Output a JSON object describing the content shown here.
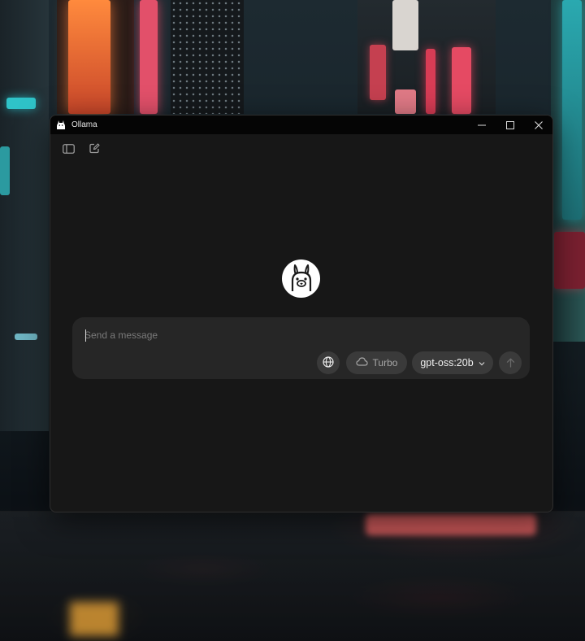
{
  "window": {
    "title": "Ollama",
    "icon": "ollama-llama-icon"
  },
  "titlebar_controls": [
    {
      "name": "minimize",
      "icon": "minimize-icon"
    },
    {
      "name": "maximize",
      "icon": "maximize-icon"
    },
    {
      "name": "close",
      "icon": "close-icon"
    }
  ],
  "toolbar": {
    "sidebar_toggle_icon": "sidebar-icon",
    "new_chat_icon": "new-chat-icon"
  },
  "composer": {
    "placeholder": "Send a message",
    "value": "",
    "web_search_icon": "globe-icon",
    "turbo_label": "Turbo",
    "turbo_icon": "cloud-icon",
    "model_label": "gpt-oss:20b",
    "model_icon": "chevron-down-icon",
    "send_icon": "arrow-up-icon"
  },
  "colors": {
    "window_bg": "#171717",
    "titlebar_bg": "#050505",
    "composer_bg": "#262626",
    "pill_bg": "#3a3a3a",
    "placeholder_text": "#7a7a7a"
  }
}
